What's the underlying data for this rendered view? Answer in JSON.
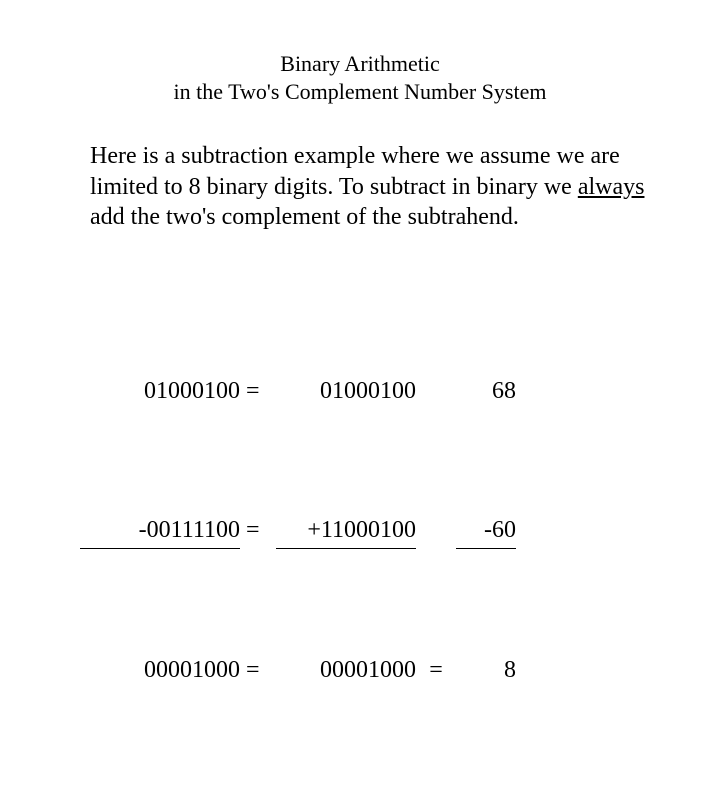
{
  "title": {
    "line1": "Binary Arithmetic",
    "line2": "in the Two's Complement Number System"
  },
  "paragraph": {
    "part1": "Here is a subtraction example where we assume we are limited to 8 binary digits. To subtract in binary we ",
    "underlined": "always",
    "part2": " add the two's complement of the subtrahend."
  },
  "math": {
    "r1": {
      "left": "01000100",
      "eq1": "=",
      "mid": "01000100",
      "eq2": "",
      "right": "68"
    },
    "r2": {
      "left": "-00111100",
      "eq1": "=",
      "mid": "+11000100",
      "eq2": "",
      "right": "-60"
    },
    "r3": {
      "left": "00001000",
      "eq1": "=",
      "mid": "00001000",
      "eq2": "=",
      "right": "8"
    }
  }
}
